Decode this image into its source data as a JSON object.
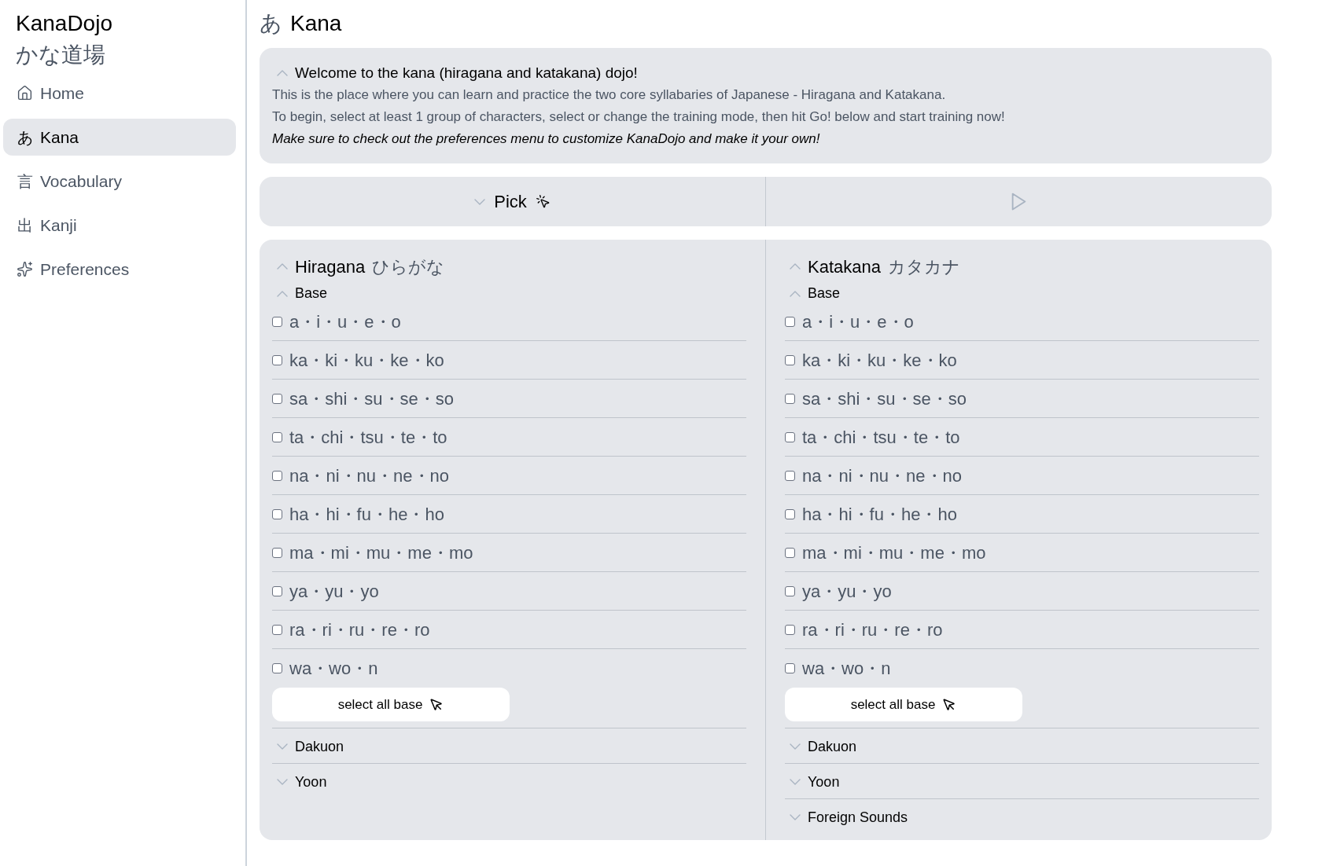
{
  "sidebar": {
    "brand": "KanaDojo",
    "brand_native": "かな道場",
    "items": [
      {
        "kind": "icon",
        "label": "Home",
        "selected": false
      },
      {
        "kind": "glyph",
        "glyph": "あ",
        "label": "Kana",
        "selected": true
      },
      {
        "kind": "glyph",
        "glyph": "言",
        "label": "Vocabulary",
        "selected": false
      },
      {
        "kind": "glyph",
        "glyph": "出",
        "label": "Kanji",
        "selected": false
      },
      {
        "kind": "icon",
        "label": "Preferences",
        "selected": false
      }
    ]
  },
  "page": {
    "glyph": "あ",
    "title": "Kana"
  },
  "welcome": {
    "expanded": true,
    "title": "Welcome to the kana (hiragana and katakana) dojo!",
    "paragraphs": [
      {
        "kind": "plain",
        "text": "This is the place where you can learn and practice the two core syllabaries of Japanese - Hiragana and Katakana."
      },
      {
        "kind": "plain",
        "text": "To begin, select at least 1 group of characters, select or change the training mode, then hit Go! below and start training now!"
      },
      {
        "kind": "emphasis",
        "text": "Make sure to check out the preferences menu to customize KanaDojo and make it your own!"
      }
    ]
  },
  "pick_bar": {
    "pick": {
      "label": "Pick",
      "expanded": false
    },
    "start_button": {
      "disabled": true
    }
  },
  "columns": [
    {
      "name": "Hiragana",
      "native": "ひらがな",
      "expanded": true,
      "groups": [
        {
          "name": "Base",
          "expanded": true,
          "rows": [
            {
              "label": "a・i・u・e・o",
              "checked": false
            },
            {
              "label": "ka・ki・ku・ke・ko",
              "checked": false
            },
            {
              "label": "sa・shi・su・se・so",
              "checked": false
            },
            {
              "label": "ta・chi・tsu・te・to",
              "checked": false
            },
            {
              "label": "na・ni・nu・ne・no",
              "checked": false
            },
            {
              "label": "ha・hi・fu・he・ho",
              "checked": false
            },
            {
              "label": "ma・mi・mu・me・mo",
              "checked": false
            },
            {
              "label": "ya・yu・yo",
              "checked": false
            },
            {
              "label": "ra・ri・ru・re・ro",
              "checked": false
            },
            {
              "label": "wa・wo・n",
              "checked": false
            }
          ],
          "select_all": "select all base"
        },
        {
          "name": "Dakuon",
          "expanded": false
        },
        {
          "name": "Yoon",
          "expanded": false
        }
      ]
    },
    {
      "name": "Katakana",
      "native": "カタカナ",
      "expanded": true,
      "groups": [
        {
          "name": "Base",
          "expanded": true,
          "rows": [
            {
              "label": "a・i・u・e・o",
              "checked": false
            },
            {
              "label": "ka・ki・ku・ke・ko",
              "checked": false
            },
            {
              "label": "sa・shi・su・se・so",
              "checked": false
            },
            {
              "label": "ta・chi・tsu・te・to",
              "checked": false
            },
            {
              "label": "na・ni・nu・ne・no",
              "checked": false
            },
            {
              "label": "ha・hi・fu・he・ho",
              "checked": false
            },
            {
              "label": "ma・mi・mu・me・mo",
              "checked": false
            },
            {
              "label": "ya・yu・yo",
              "checked": false
            },
            {
              "label": "ra・ri・ru・re・ro",
              "checked": false
            },
            {
              "label": "wa・wo・n",
              "checked": false
            }
          ],
          "select_all": "select all base"
        },
        {
          "name": "Dakuon",
          "expanded": false
        },
        {
          "name": "Yoon",
          "expanded": false
        },
        {
          "name": "Foreign Sounds",
          "expanded": false
        }
      ]
    }
  ]
}
